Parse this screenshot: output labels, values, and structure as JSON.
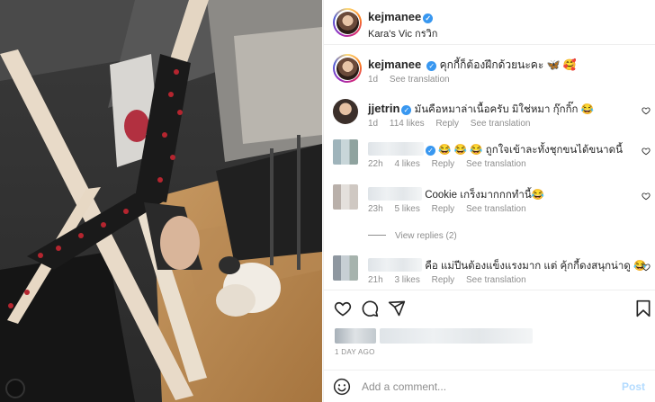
{
  "post": {
    "username": "kejmanee",
    "location": "Kara's Vic กรวิก",
    "verified": "✓"
  },
  "caption": {
    "username": "kejmanee",
    "text": "คุกกี้ก็ต้องฝึกด้วยนะคะ 🦋 🥰",
    "time": "1d",
    "translate": "See translation"
  },
  "comments": [
    {
      "username": "jjetrin",
      "text": "มันคือหมาล่าเนื้อครับ มิใช่หมา กุ๊กกิ๊ก 😂",
      "time": "1d",
      "likes": "114 likes",
      "reply": "Reply",
      "translate": "See translation"
    },
    {
      "username": "",
      "text": "😂 😂 😂 ถูกใจเข้าละทั้งชุกขนได้ขนาดนี้",
      "time": "22h",
      "likes": "4 likes",
      "reply": "Reply",
      "translate": "See translation"
    },
    {
      "username": "",
      "text": "Cookie เกร็งมากกกทำนี้😂",
      "time": "23h",
      "likes": "5 likes",
      "reply": "Reply",
      "translate": "See translation"
    },
    {
      "username": "",
      "text": "คือ แม่ปีนต้องแข็งแรงมาก แต่ คุ้กกี้ดงสนุกน่าดู 😂",
      "time": "21h",
      "likes": "3 likes",
      "reply": "Reply",
      "translate": "See translation"
    }
  ],
  "view_replies": "View replies (2)",
  "time_ago": "1 DAY AGO",
  "add_comment": {
    "placeholder": "Add a comment...",
    "post_label": "Post"
  },
  "icons": [
    "heart-icon",
    "comment-icon",
    "share-icon",
    "bookmark-icon",
    "emoji-icon",
    "verified-icon"
  ],
  "colors": {
    "verified": "#3897f0",
    "link_gray": "#8e8e8e",
    "post_disabled": "#b3dbff"
  }
}
